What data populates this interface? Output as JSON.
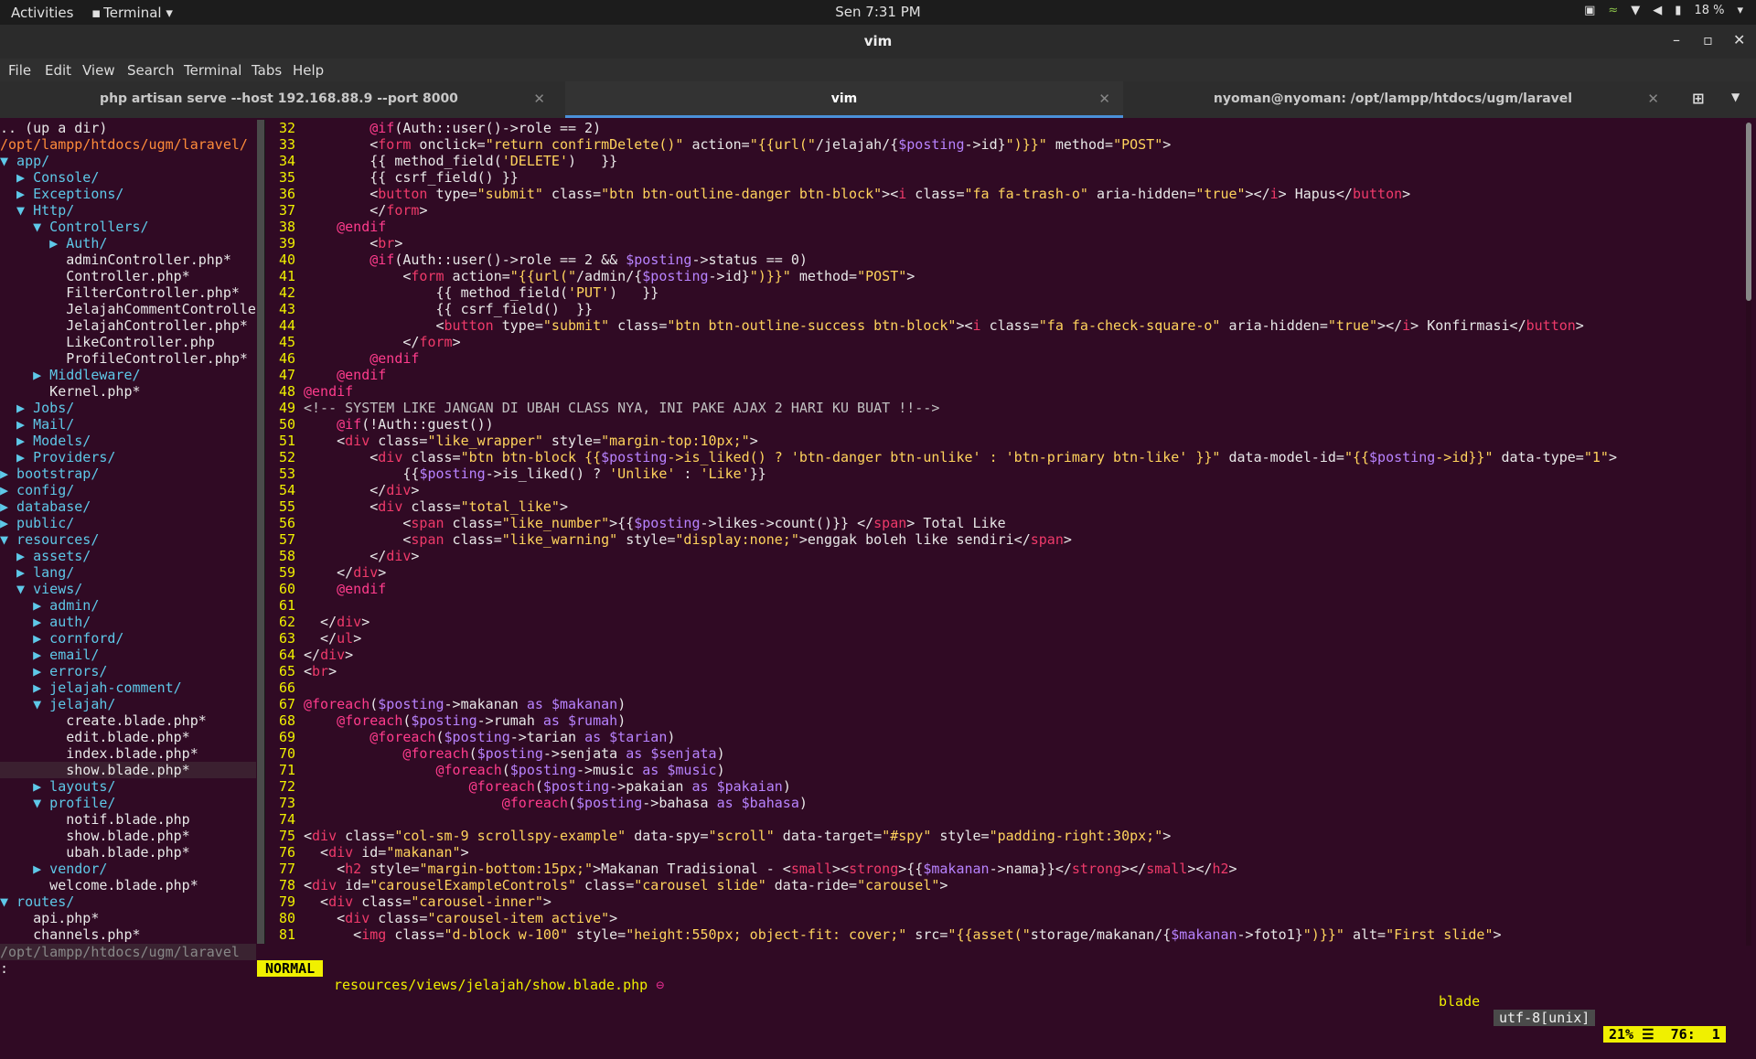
{
  "topbar": {
    "activities": "Activities",
    "app": "Terminal",
    "clock": "Sen  7:31 PM",
    "battery": "18 %"
  },
  "window": {
    "title": "vim"
  },
  "menu": [
    "File",
    "Edit",
    "View",
    "Search",
    "Terminal",
    "Tabs",
    "Help"
  ],
  "tabs": [
    {
      "label": "php artisan serve --host 192.168.88.9 --port 8000",
      "active": false
    },
    {
      "label": "vim",
      "active": true
    },
    {
      "label": "nyoman@nyoman: /opt/lampp/htdocs/ugm/laravel",
      "active": false
    }
  ],
  "tree": [
    {
      "t": ".. (up a dir)",
      "d": false
    },
    {
      "t": "/opt/lampp/htdocs/ugm/laravel/",
      "root": true
    },
    {
      "t": "▼ app/",
      "d": true
    },
    {
      "t": "  ▶ Console/",
      "d": true
    },
    {
      "t": "  ▶ Exceptions/",
      "d": true
    },
    {
      "t": "  ▼ Http/",
      "d": true
    },
    {
      "t": "    ▼ Controllers/",
      "d": true
    },
    {
      "t": "      ▶ Auth/",
      "d": true
    },
    {
      "t": "        adminController.php*"
    },
    {
      "t": "        Controller.php*"
    },
    {
      "t": "        FilterController.php*"
    },
    {
      "t": "        JelajahCommentControlle"
    },
    {
      "t": "        JelajahController.php*"
    },
    {
      "t": "        LikeController.php"
    },
    {
      "t": "        ProfileController.php*"
    },
    {
      "t": "    ▶ Middleware/",
      "d": true
    },
    {
      "t": "      Kernel.php*"
    },
    {
      "t": "  ▶ Jobs/",
      "d": true
    },
    {
      "t": "  ▶ Mail/",
      "d": true
    },
    {
      "t": "  ▶ Models/",
      "d": true
    },
    {
      "t": "  ▶ Providers/",
      "d": true
    },
    {
      "t": "▶ bootstrap/",
      "d": true
    },
    {
      "t": "▶ config/",
      "d": true
    },
    {
      "t": "▶ database/",
      "d": true
    },
    {
      "t": "▶ public/",
      "d": true
    },
    {
      "t": "▼ resources/",
      "d": true
    },
    {
      "t": "  ▶ assets/",
      "d": true
    },
    {
      "t": "  ▶ lang/",
      "d": true
    },
    {
      "t": "  ▼ views/",
      "d": true
    },
    {
      "t": "    ▶ admin/",
      "d": true
    },
    {
      "t": "    ▶ auth/",
      "d": true
    },
    {
      "t": "    ▶ cornford/",
      "d": true
    },
    {
      "t": "    ▶ email/",
      "d": true
    },
    {
      "t": "    ▶ errors/",
      "d": true
    },
    {
      "t": "    ▶ jelajah-comment/",
      "d": true
    },
    {
      "t": "    ▼ jelajah/",
      "d": true
    },
    {
      "t": "        create.blade.php*"
    },
    {
      "t": "        edit.blade.php*"
    },
    {
      "t": "        index.blade.php*"
    },
    {
      "t": "        show.blade.php*",
      "sel": true
    },
    {
      "t": "    ▶ layouts/",
      "d": true
    },
    {
      "t": "    ▼ profile/",
      "d": true
    },
    {
      "t": "        notif.blade.php"
    },
    {
      "t": "        show.blade.php*"
    },
    {
      "t": "        ubah.blade.php*"
    },
    {
      "t": "    ▶ vendor/",
      "d": true
    },
    {
      "t": "      welcome.blade.php*"
    },
    {
      "t": "▼ routes/",
      "d": true
    },
    {
      "t": "    api.php*"
    },
    {
      "t": "    channels.php*"
    }
  ],
  "tree_status": "/opt/lampp/htdocs/ugm/laravel",
  "code_lines": [
    {
      "n": "32",
      "t": "        @if(Auth::user()->role == 2)"
    },
    {
      "n": "33",
      "t": "        <form onclick=\"return confirmDelete()\" action=\"{{url(\"/jelajah/{$posting->id}\")}}\" method=\"POST\">"
    },
    {
      "n": "34",
      "t": "        {{ method_field('DELETE')   }}"
    },
    {
      "n": "35",
      "t": "        {{ csrf_field() }}"
    },
    {
      "n": "36",
      "t": "        <button type=\"submit\" class=\"btn btn-outline-danger btn-block\"><i class=\"fa fa-trash-o\" aria-hidden=\"true\"></i> Hapus</button>"
    },
    {
      "n": "37",
      "t": "        </form>"
    },
    {
      "n": "38",
      "t": "    @endif"
    },
    {
      "n": "39",
      "t": "        <br>"
    },
    {
      "n": "40",
      "t": "        @if(Auth::user()->role == 2 && $posting->status == 0)"
    },
    {
      "n": "41",
      "t": "            <form action=\"{{url(\"/admin/{$posting->id}\")}}\" method=\"POST\">"
    },
    {
      "n": "42",
      "t": "                {{ method_field('PUT')   }}"
    },
    {
      "n": "43",
      "t": "                {{ csrf_field()  }}"
    },
    {
      "n": "44",
      "t": "                <button type=\"submit\" class=\"btn btn-outline-success btn-block\"><i class=\"fa fa-check-square-o\" aria-hidden=\"true\"></i> Konfirmasi</button>"
    },
    {
      "n": "45",
      "t": "            </form>"
    },
    {
      "n": "46",
      "t": "        @endif"
    },
    {
      "n": "47",
      "t": "    @endif"
    },
    {
      "n": "48",
      "t": "@endif"
    },
    {
      "n": "49",
      "t": "<!-- SYSTEM LIKE JANGAN DI UBAH CLASS NYA, INI PAKE AJAX 2 HARI KU BUAT !!-->"
    },
    {
      "n": "50",
      "t": "    @if(!Auth::guest())"
    },
    {
      "n": "51",
      "t": "    <div class=\"like_wrapper\" style=\"margin-top:10px;\">"
    },
    {
      "n": "52",
      "t": "        <div class=\"btn btn-block {{$posting->is_liked() ? 'btn-danger btn-unlike' : 'btn-primary btn-like' }}\" data-model-id=\"{{$posting->id}}\" data-type=\"1\">"
    },
    {
      "n": "53",
      "t": "            {{$posting->is_liked() ? 'Unlike' : 'Like'}}"
    },
    {
      "n": "54",
      "t": "        </div>"
    },
    {
      "n": "55",
      "t": "        <div class=\"total_like\">"
    },
    {
      "n": "56",
      "t": "            <span class=\"like_number\">{{$posting->likes->count()}} </span> Total Like"
    },
    {
      "n": "57",
      "t": "            <span class=\"like_warning\" style=\"display:none;\">enggak boleh like sendiri</span>"
    },
    {
      "n": "58",
      "t": "        </div>"
    },
    {
      "n": "59",
      "t": "    </div>"
    },
    {
      "n": "60",
      "t": "    @endif"
    },
    {
      "n": "61",
      "t": ""
    },
    {
      "n": "62",
      "t": "  </div>"
    },
    {
      "n": "63",
      "t": "  </ul>"
    },
    {
      "n": "64",
      "t": "</div>"
    },
    {
      "n": "65",
      "t": "<br>"
    },
    {
      "n": "66",
      "t": ""
    },
    {
      "n": "67",
      "t": "@foreach($posting->makanan as $makanan)"
    },
    {
      "n": "68",
      "t": "    @foreach($posting->rumah as $rumah)"
    },
    {
      "n": "69",
      "t": "        @foreach($posting->tarian as $tarian)"
    },
    {
      "n": "70",
      "t": "            @foreach($posting->senjata as $senjata)"
    },
    {
      "n": "71",
      "t": "                @foreach($posting->music as $music)"
    },
    {
      "n": "72",
      "t": "                    @foreach($posting->pakaian as $pakaian)"
    },
    {
      "n": "73",
      "t": "                        @foreach($posting->bahasa as $bahasa)"
    },
    {
      "n": "74",
      "t": ""
    },
    {
      "n": "75",
      "t": "<div class=\"col-sm-9 scrollspy-example\" data-spy=\"scroll\" data-target=\"#spy\" style=\"padding-right:30px;\">"
    },
    {
      "n": "76",
      "t": "  <div id=\"makanan\">"
    },
    {
      "n": "77",
      "t": "    <h2 style=\"margin-bottom:15px;\">Makanan Tradisional - <small><strong>{{$makanan->nama}}</strong></small></h2>"
    },
    {
      "n": "78",
      "t": "<div id=\"carouselExampleControls\" class=\"carousel slide\" data-ride=\"carousel\">"
    },
    {
      "n": "79",
      "t": "  <div class=\"carousel-inner\">"
    },
    {
      "n": "80",
      "t": "    <div class=\"carousel-item active\">"
    },
    {
      "n": "81",
      "t": "      <img class=\"d-block w-100\" style=\"height:550px; object-fit: cover;\" src=\"{{asset(\"storage/makanan/{$makanan->foto1}\")}}\" alt=\"First slide\">"
    }
  ],
  "statusline": {
    "mode": "NORMAL",
    "file": "resources/views/jelajah/show.blade.php",
    "filetype": "blade",
    "encoding": "utf-8[unix]",
    "position": "21% ☰  76:  1"
  },
  "cmdline": ":"
}
